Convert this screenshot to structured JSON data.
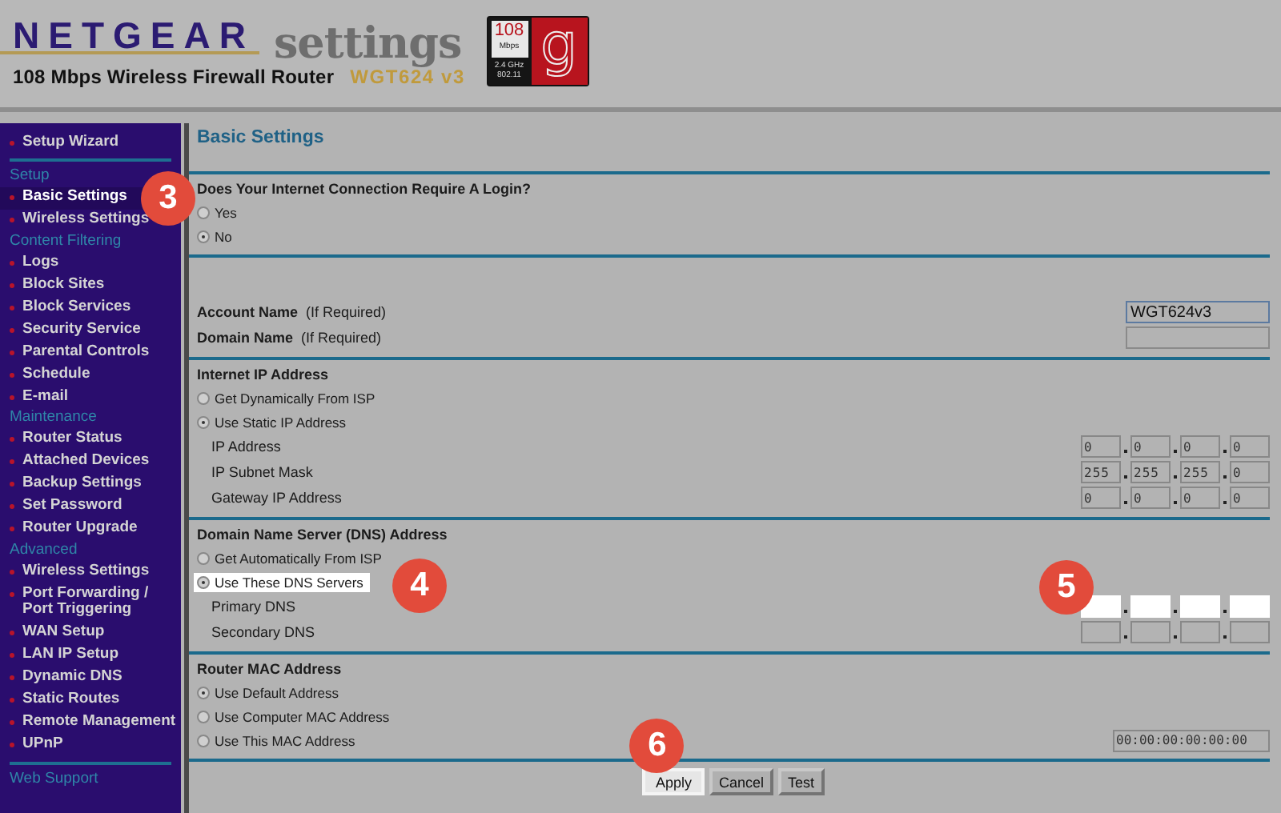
{
  "header": {
    "brand": "NETGEAR",
    "product_line": "settings",
    "subtitle": "108 Mbps Wireless Firewall Router",
    "model": "WGT624 v3",
    "badge": {
      "speed": "108",
      "unit": "Mbps",
      "band": "2.4 GHz",
      "standard": "802.11",
      "letter": "g"
    }
  },
  "sidebar": {
    "items": [
      {
        "kind": "link",
        "label": "Setup Wizard",
        "selected": false
      },
      {
        "kind": "divider"
      },
      {
        "kind": "heading",
        "label": "Setup"
      },
      {
        "kind": "link",
        "label": "Basic Settings",
        "selected": true,
        "callout": {
          "label": "3"
        }
      },
      {
        "kind": "link",
        "label": "Wireless Settings",
        "selected": false
      },
      {
        "kind": "heading",
        "label": "Content Filtering"
      },
      {
        "kind": "link",
        "label": "Logs",
        "selected": false
      },
      {
        "kind": "link",
        "label": "Block Sites",
        "selected": false
      },
      {
        "kind": "link",
        "label": "Block Services",
        "selected": false
      },
      {
        "kind": "link",
        "label": "Security Service",
        "selected": false
      },
      {
        "kind": "link",
        "label": "Parental Controls",
        "selected": false
      },
      {
        "kind": "link",
        "label": "Schedule",
        "selected": false
      },
      {
        "kind": "link",
        "label": "E-mail",
        "selected": false
      },
      {
        "kind": "heading",
        "label": "Maintenance"
      },
      {
        "kind": "link",
        "label": "Router Status",
        "selected": false
      },
      {
        "kind": "link",
        "label": "Attached Devices",
        "selected": false
      },
      {
        "kind": "link",
        "label": "Backup Settings",
        "selected": false
      },
      {
        "kind": "link",
        "label": "Set Password",
        "selected": false
      },
      {
        "kind": "link",
        "label": "Router Upgrade",
        "selected": false
      },
      {
        "kind": "heading",
        "label": "Advanced"
      },
      {
        "kind": "link",
        "label": "Wireless Settings",
        "selected": false
      },
      {
        "kind": "link",
        "label": "Port Forwarding / Port Triggering",
        "selected": false
      },
      {
        "kind": "link",
        "label": "WAN Setup",
        "selected": false
      },
      {
        "kind": "link",
        "label": "LAN IP Setup",
        "selected": false
      },
      {
        "kind": "link",
        "label": "Dynamic DNS",
        "selected": false
      },
      {
        "kind": "link",
        "label": "Static Routes",
        "selected": false
      },
      {
        "kind": "link",
        "label": "Remote Management",
        "selected": false
      },
      {
        "kind": "link",
        "label": "UPnP",
        "selected": false
      },
      {
        "kind": "divider"
      },
      {
        "kind": "heading",
        "label": "Web Support"
      }
    ]
  },
  "page": {
    "title": "Basic Settings",
    "sections": [
      {
        "heading": "Does Your Internet Connection Require A Login?",
        "rows": [
          {
            "kind": "radio",
            "label": "Yes",
            "selected": false,
            "highlighted": false
          },
          {
            "kind": "radio",
            "label": "No",
            "selected": true,
            "highlighted": false
          }
        ]
      },
      {
        "rows": [
          {
            "kind": "text-field",
            "label": "Account Name",
            "note": "(If Required)",
            "value": "WGT624v3",
            "focused": true
          },
          {
            "kind": "text-field",
            "label": "Domain Name",
            "note": "(If Required)",
            "focused": false
          }
        ]
      },
      {
        "heading": "Internet IP Address",
        "rows": [
          {
            "kind": "radio",
            "label": "Get Dynamically From ISP",
            "selected": false,
            "highlighted": false
          },
          {
            "kind": "radio",
            "label": "Use Static IP Address",
            "selected": true,
            "highlighted": false
          },
          {
            "kind": "ip",
            "label": "IP Address",
            "octets": [
              "0",
              "0",
              "0",
              "0"
            ],
            "highlighted": false
          },
          {
            "kind": "ip",
            "label": "IP Subnet Mask",
            "octets": [
              "255",
              "255",
              "255",
              "0"
            ],
            "highlighted": false
          },
          {
            "kind": "ip",
            "label": "Gateway IP Address",
            "octets": [
              "0",
              "0",
              "0",
              "0"
            ],
            "highlighted": false
          }
        ]
      },
      {
        "heading": "Domain Name Server (DNS) Address",
        "rows": [
          {
            "kind": "radio",
            "label": "Get Automatically From ISP",
            "selected": false,
            "highlighted": false
          },
          {
            "kind": "radio",
            "label": "Use These DNS Servers",
            "selected": true,
            "highlighted": true,
            "callout": {
              "label": "4"
            }
          },
          {
            "kind": "ip",
            "label": "Primary DNS",
            "highlighted": true,
            "callout": {
              "label": "5"
            }
          },
          {
            "kind": "ip",
            "label": "Secondary DNS",
            "highlighted": false
          }
        ]
      },
      {
        "heading": "Router MAC Address",
        "rows": [
          {
            "kind": "radio",
            "label": "Use Default Address",
            "selected": true,
            "highlighted": false
          },
          {
            "kind": "radio",
            "label": "Use Computer MAC Address",
            "selected": false,
            "highlighted": false
          },
          {
            "kind": "radio",
            "label": "Use This MAC Address",
            "selected": false,
            "highlighted": false,
            "field": {
              "value": "00:00:00:00:00:00"
            }
          }
        ]
      }
    ]
  },
  "buttons": [
    {
      "label": "Apply",
      "highlighted": true,
      "callout": {
        "label": "6"
      }
    },
    {
      "label": "Cancel",
      "highlighted": false
    },
    {
      "label": "Test",
      "highlighted": false
    }
  ]
}
